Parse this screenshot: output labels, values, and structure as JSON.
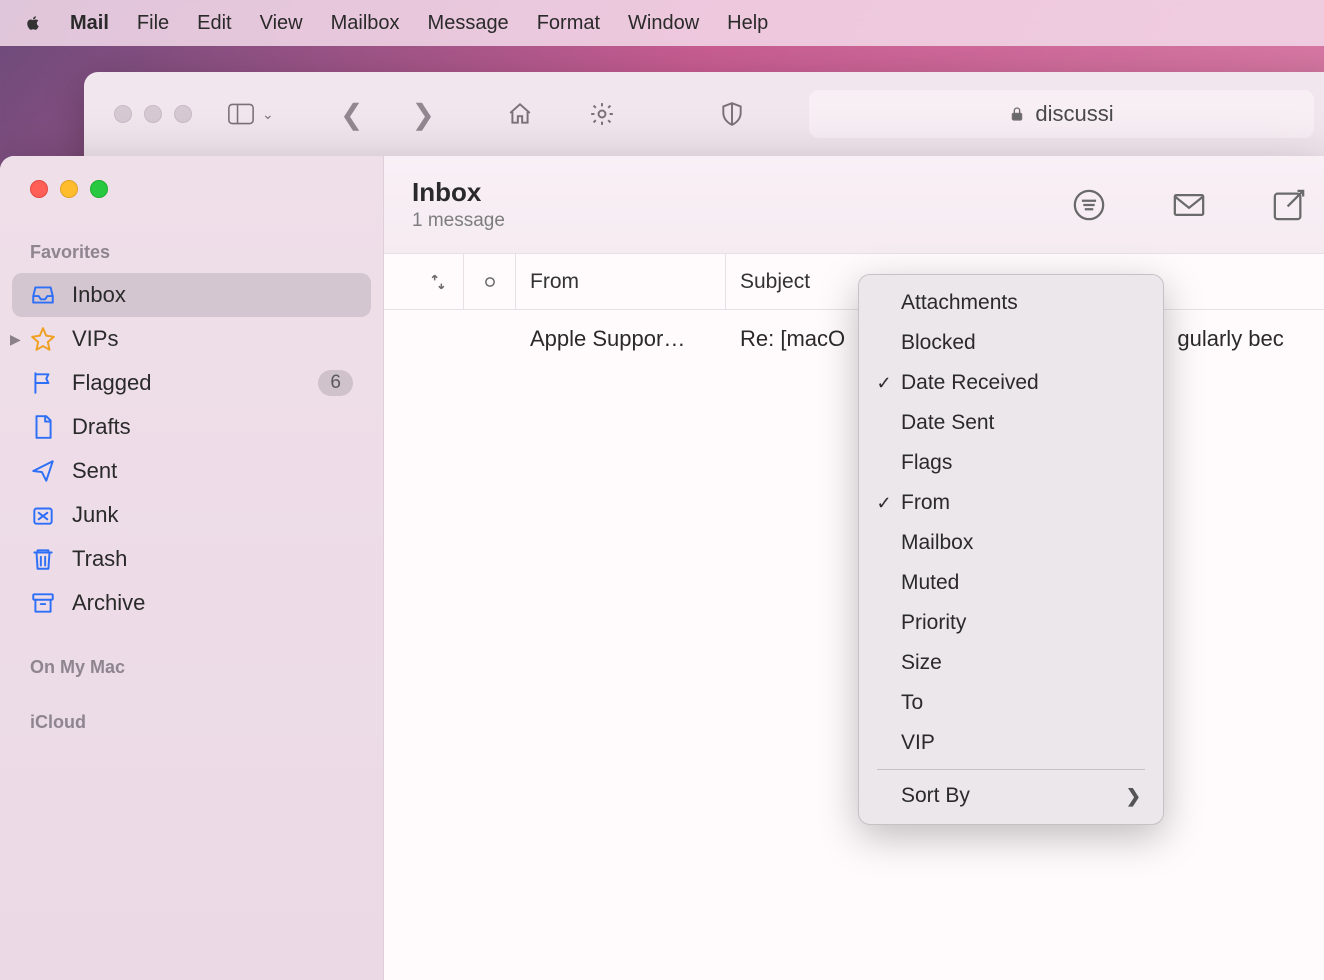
{
  "menubar": {
    "app": "Mail",
    "items": [
      "File",
      "Edit",
      "View",
      "Mailbox",
      "Message",
      "Format",
      "Window",
      "Help"
    ]
  },
  "safari": {
    "url_host": "discussi",
    "lock": "true"
  },
  "mail": {
    "title": "Inbox",
    "count": "1 message",
    "sidebar": {
      "sections": [
        {
          "label": "Favorites",
          "items": [
            {
              "name": "Inbox",
              "icon": "inbox",
              "selected": true
            },
            {
              "name": "VIPs",
              "icon": "star",
              "disclosure": true
            },
            {
              "name": "Flagged",
              "icon": "flag",
              "badge": "6"
            },
            {
              "name": "Drafts",
              "icon": "doc"
            },
            {
              "name": "Sent",
              "icon": "send"
            },
            {
              "name": "Junk",
              "icon": "junk"
            },
            {
              "name": "Trash",
              "icon": "trash"
            },
            {
              "name": "Archive",
              "icon": "archive"
            }
          ]
        },
        {
          "label": "On My Mac",
          "items": []
        },
        {
          "label": "iCloud",
          "items": []
        }
      ]
    },
    "columns": {
      "from": "From",
      "subject": "Subject"
    },
    "messages": [
      {
        "from": "Apple Suppor…",
        "subject_left": "Re: [macO",
        "subject_right": "gularly bec"
      }
    ]
  },
  "context_menu": {
    "items": [
      {
        "label": "Attachments",
        "checked": false
      },
      {
        "label": "Blocked",
        "checked": false
      },
      {
        "label": "Date Received",
        "checked": true
      },
      {
        "label": "Date Sent",
        "checked": false
      },
      {
        "label": "Flags",
        "checked": false
      },
      {
        "label": "From",
        "checked": true
      },
      {
        "label": "Mailbox",
        "checked": false
      },
      {
        "label": "Muted",
        "checked": false
      },
      {
        "label": "Priority",
        "checked": false
      },
      {
        "label": "Size",
        "checked": false
      },
      {
        "label": "To",
        "checked": false
      },
      {
        "label": "VIP",
        "checked": false
      }
    ],
    "sort_by": "Sort By"
  }
}
